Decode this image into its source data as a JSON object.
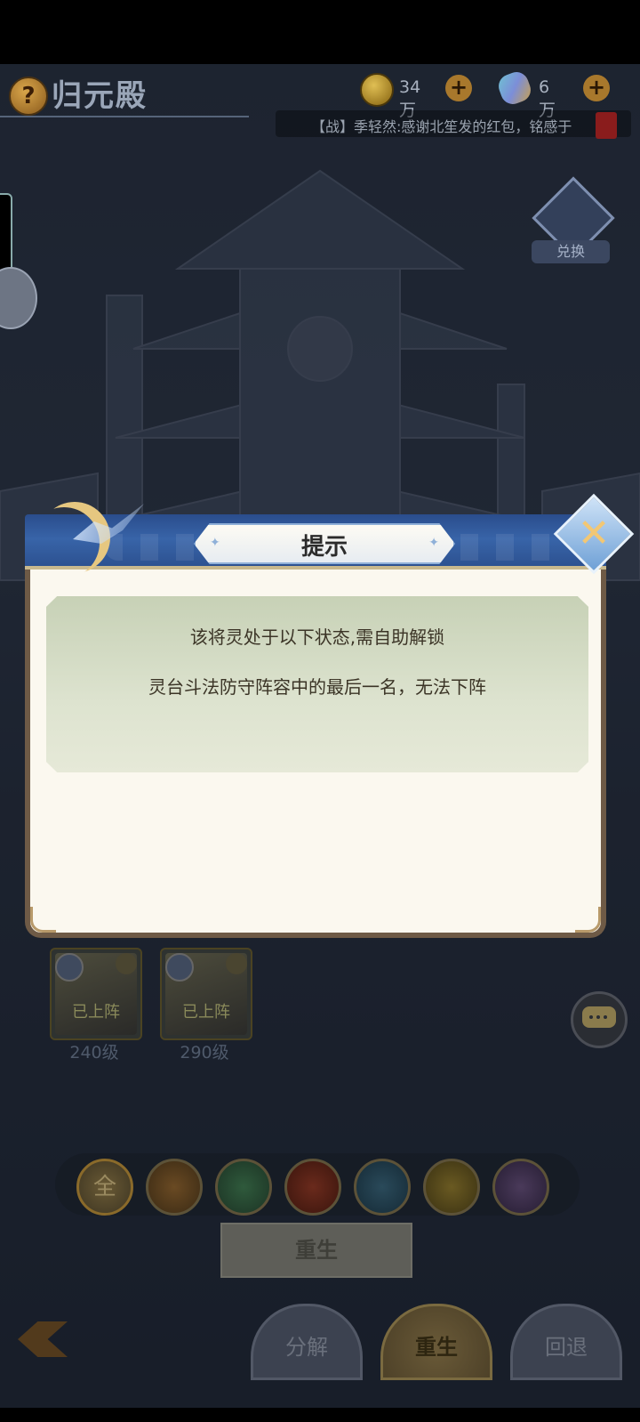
{
  "header": {
    "title": "归元殿",
    "help_icon": "?",
    "resources": [
      {
        "name": "coin",
        "value": "34万"
      },
      {
        "name": "gem",
        "value": "6万"
      }
    ],
    "plus": "+",
    "ticker": "【战】季轻然:感谢北笙发的红包，铭感于"
  },
  "exchange": {
    "label": "兑换"
  },
  "heroes": [
    {
      "status": "已上阵",
      "level": "240级"
    },
    {
      "status": "已上阵",
      "level": "290级"
    }
  ],
  "filters": {
    "all_label": "全"
  },
  "rebirth_button": "重生",
  "bottom_tabs": [
    {
      "label": "分解",
      "active": false
    },
    {
      "label": "重生",
      "active": true
    },
    {
      "label": "回退",
      "active": false
    }
  ],
  "dialog": {
    "title": "提示",
    "line1": "该将灵处于以下状态,需自助解锁",
    "line2": "灵台斗法防守阵容中的最后一名，无法下阵",
    "close_symbol": "✕"
  },
  "colors": {
    "header_blue": "#3864a8",
    "body_cream": "#fbf8ef",
    "message_green": "#c7d1b6",
    "gold": "#e6c780"
  }
}
